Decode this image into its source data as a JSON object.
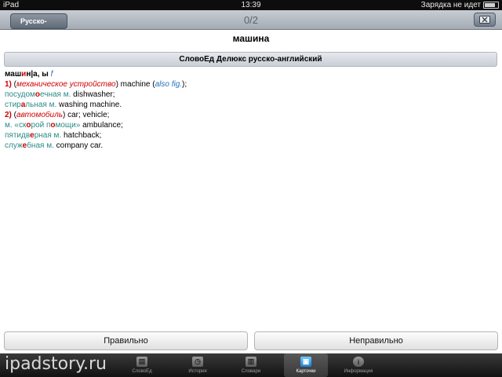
{
  "status_bar": {
    "device": "iPad",
    "time": "13:39",
    "battery_text": "Зарядка не идет"
  },
  "nav": {
    "back_label": "Русско-Английское",
    "counter": "0/2"
  },
  "headword": "машина",
  "dictionary_name": "СловоЕд Делюкс русско-английский",
  "article": {
    "l1": {
      "pre": "маш",
      "stress": "и",
      "post": "н|а, ы",
      "gender": "f"
    },
    "l2": {
      "num": "1)",
      "open": " (",
      "gloss": "механическое устройство",
      "mid": ") machine (",
      "ref": "also fig.",
      "close": ");"
    },
    "l3": {
      "pre": "посудом",
      "stress": "о",
      "post": "ечная м.",
      "trans": " dishwasher;"
    },
    "l4": {
      "pre": "стир",
      "stress": "а",
      "post": "льная м.",
      "trans": " washing machine."
    },
    "l5": {
      "num": "2)",
      "open": " (",
      "gloss": "автомобиль",
      "trans": ") car; vehicle;"
    },
    "l6": {
      "pre": "м. «ск",
      "stress1": "о",
      "mid": "рой п",
      "stress2": "о",
      "post": "мощи»",
      "trans": " ambulance;"
    },
    "l7": {
      "pre": "пятидв",
      "stress": "е",
      "post": "рная м.",
      "trans": " hatchback;"
    },
    "l8": {
      "pre": "служ",
      "stress": "е",
      "post": "бная м.",
      "trans": " company car."
    }
  },
  "buttons": {
    "correct": "Правильно",
    "incorrect": "Неправильно"
  },
  "tabs": [
    {
      "label": "СловоЕд",
      "icon": "book-icon"
    },
    {
      "label": "История",
      "icon": "history-icon"
    },
    {
      "label": "Словари",
      "icon": "dictionaries-icon"
    },
    {
      "label": "Карточки",
      "icon": "cards-icon"
    },
    {
      "label": "Информация",
      "icon": "info-icon"
    }
  ],
  "watermark": "ipadstory.ru",
  "colors": {
    "accent_red": "#d00000",
    "teal": "#2a8a86",
    "link_blue": "#1f6fc0"
  }
}
